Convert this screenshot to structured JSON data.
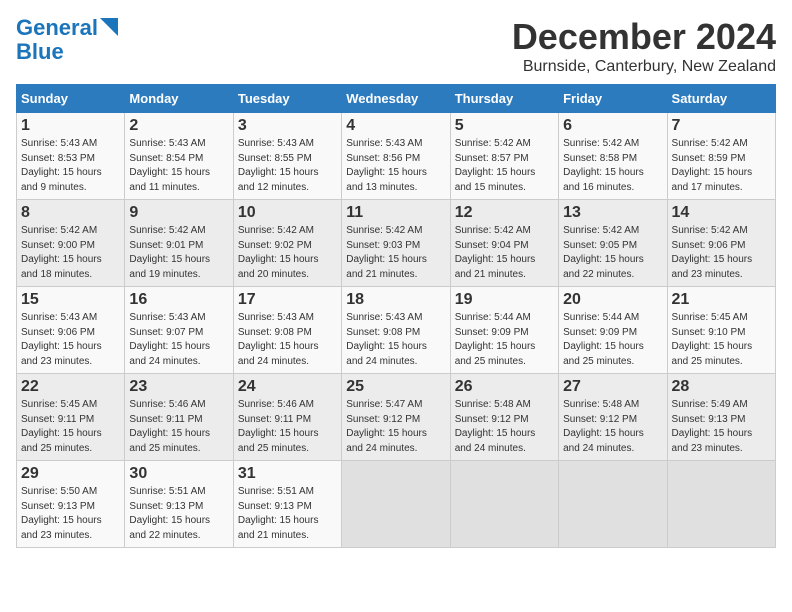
{
  "logo": {
    "line1": "General",
    "line2": "Blue"
  },
  "title": "December 2024",
  "subtitle": "Burnside, Canterbury, New Zealand",
  "weekdays": [
    "Sunday",
    "Monday",
    "Tuesday",
    "Wednesday",
    "Thursday",
    "Friday",
    "Saturday"
  ],
  "weeks": [
    [
      {
        "day": "1",
        "detail": "Sunrise: 5:43 AM\nSunset: 8:53 PM\nDaylight: 15 hours\nand 9 minutes."
      },
      {
        "day": "2",
        "detail": "Sunrise: 5:43 AM\nSunset: 8:54 PM\nDaylight: 15 hours\nand 11 minutes."
      },
      {
        "day": "3",
        "detail": "Sunrise: 5:43 AM\nSunset: 8:55 PM\nDaylight: 15 hours\nand 12 minutes."
      },
      {
        "day": "4",
        "detail": "Sunrise: 5:43 AM\nSunset: 8:56 PM\nDaylight: 15 hours\nand 13 minutes."
      },
      {
        "day": "5",
        "detail": "Sunrise: 5:42 AM\nSunset: 8:57 PM\nDaylight: 15 hours\nand 15 minutes."
      },
      {
        "day": "6",
        "detail": "Sunrise: 5:42 AM\nSunset: 8:58 PM\nDaylight: 15 hours\nand 16 minutes."
      },
      {
        "day": "7",
        "detail": "Sunrise: 5:42 AM\nSunset: 8:59 PM\nDaylight: 15 hours\nand 17 minutes."
      }
    ],
    [
      {
        "day": "8",
        "detail": "Sunrise: 5:42 AM\nSunset: 9:00 PM\nDaylight: 15 hours\nand 18 minutes."
      },
      {
        "day": "9",
        "detail": "Sunrise: 5:42 AM\nSunset: 9:01 PM\nDaylight: 15 hours\nand 19 minutes."
      },
      {
        "day": "10",
        "detail": "Sunrise: 5:42 AM\nSunset: 9:02 PM\nDaylight: 15 hours\nand 20 minutes."
      },
      {
        "day": "11",
        "detail": "Sunrise: 5:42 AM\nSunset: 9:03 PM\nDaylight: 15 hours\nand 21 minutes."
      },
      {
        "day": "12",
        "detail": "Sunrise: 5:42 AM\nSunset: 9:04 PM\nDaylight: 15 hours\nand 21 minutes."
      },
      {
        "day": "13",
        "detail": "Sunrise: 5:42 AM\nSunset: 9:05 PM\nDaylight: 15 hours\nand 22 minutes."
      },
      {
        "day": "14",
        "detail": "Sunrise: 5:42 AM\nSunset: 9:06 PM\nDaylight: 15 hours\nand 23 minutes."
      }
    ],
    [
      {
        "day": "15",
        "detail": "Sunrise: 5:43 AM\nSunset: 9:06 PM\nDaylight: 15 hours\nand 23 minutes."
      },
      {
        "day": "16",
        "detail": "Sunrise: 5:43 AM\nSunset: 9:07 PM\nDaylight: 15 hours\nand 24 minutes."
      },
      {
        "day": "17",
        "detail": "Sunrise: 5:43 AM\nSunset: 9:08 PM\nDaylight: 15 hours\nand 24 minutes."
      },
      {
        "day": "18",
        "detail": "Sunrise: 5:43 AM\nSunset: 9:08 PM\nDaylight: 15 hours\nand 24 minutes."
      },
      {
        "day": "19",
        "detail": "Sunrise: 5:44 AM\nSunset: 9:09 PM\nDaylight: 15 hours\nand 25 minutes."
      },
      {
        "day": "20",
        "detail": "Sunrise: 5:44 AM\nSunset: 9:09 PM\nDaylight: 15 hours\nand 25 minutes."
      },
      {
        "day": "21",
        "detail": "Sunrise: 5:45 AM\nSunset: 9:10 PM\nDaylight: 15 hours\nand 25 minutes."
      }
    ],
    [
      {
        "day": "22",
        "detail": "Sunrise: 5:45 AM\nSunset: 9:11 PM\nDaylight: 15 hours\nand 25 minutes."
      },
      {
        "day": "23",
        "detail": "Sunrise: 5:46 AM\nSunset: 9:11 PM\nDaylight: 15 hours\nand 25 minutes."
      },
      {
        "day": "24",
        "detail": "Sunrise: 5:46 AM\nSunset: 9:11 PM\nDaylight: 15 hours\nand 25 minutes."
      },
      {
        "day": "25",
        "detail": "Sunrise: 5:47 AM\nSunset: 9:12 PM\nDaylight: 15 hours\nand 24 minutes."
      },
      {
        "day": "26",
        "detail": "Sunrise: 5:48 AM\nSunset: 9:12 PM\nDaylight: 15 hours\nand 24 minutes."
      },
      {
        "day": "27",
        "detail": "Sunrise: 5:48 AM\nSunset: 9:12 PM\nDaylight: 15 hours\nand 24 minutes."
      },
      {
        "day": "28",
        "detail": "Sunrise: 5:49 AM\nSunset: 9:13 PM\nDaylight: 15 hours\nand 23 minutes."
      }
    ],
    [
      {
        "day": "29",
        "detail": "Sunrise: 5:50 AM\nSunset: 9:13 PM\nDaylight: 15 hours\nand 23 minutes."
      },
      {
        "day": "30",
        "detail": "Sunrise: 5:51 AM\nSunset: 9:13 PM\nDaylight: 15 hours\nand 22 minutes."
      },
      {
        "day": "31",
        "detail": "Sunrise: 5:51 AM\nSunset: 9:13 PM\nDaylight: 15 hours\nand 21 minutes."
      },
      null,
      null,
      null,
      null
    ]
  ]
}
